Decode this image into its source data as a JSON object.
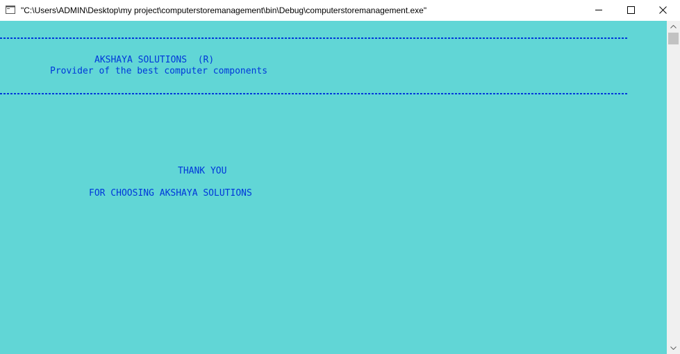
{
  "window": {
    "title": "\"C:\\Users\\ADMIN\\Desktop\\my project\\computerstoremanagement\\bin\\Debug\\computerstoremanagement.exe\"",
    "icon": "console-app-icon",
    "controls": {
      "minimize_icon": "minimize-icon",
      "maximize_icon": "maximize-icon",
      "close_icon": "close-icon"
    }
  },
  "console": {
    "background_color": "#61d6d6",
    "text_color": "#0037da",
    "company_name": "AKSHAYA SOLUTIONS  (R)",
    "tagline": "Provider of the best computer components",
    "thank_you": "THANK YOU",
    "choosing_message": "FOR CHOOSING AKSHAYA SOLUTIONS"
  }
}
